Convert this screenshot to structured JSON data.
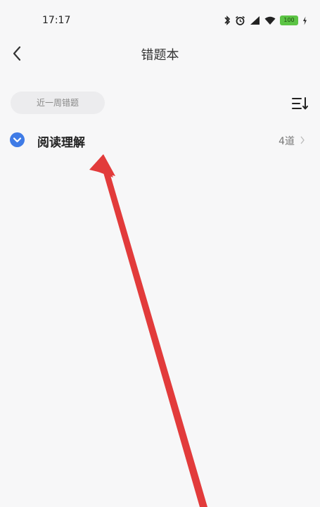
{
  "status_bar": {
    "time": "17:17",
    "battery_level": "100",
    "icons": [
      "bluetooth-icon",
      "alarm-icon",
      "signal-icon",
      "wifi-icon",
      "battery-icon",
      "charging-icon"
    ]
  },
  "nav": {
    "title": "错题本",
    "back_icon": "chevron-left-icon"
  },
  "filter": {
    "chip_label": "近一周错题",
    "sort_icon": "sort-icon"
  },
  "list": {
    "items": [
      {
        "label": "阅读理解",
        "count": "4道",
        "check_icon": "chevron-down-circle-icon"
      }
    ]
  },
  "colors": {
    "accent_blue": "#3f7be6",
    "annotation_red": "#e23b3b",
    "battery_green": "#5cc445"
  }
}
